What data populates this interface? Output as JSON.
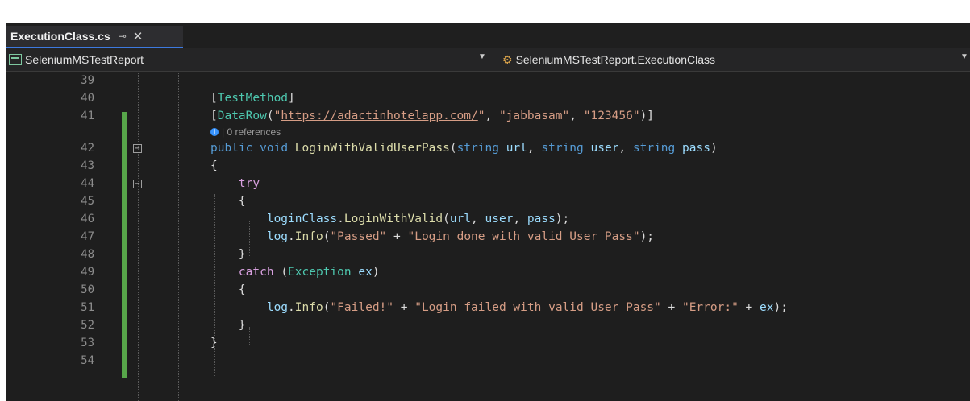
{
  "tab": {
    "title": "ExecutionClass.cs",
    "pin_icon": "pin-icon",
    "close_icon": "close-icon"
  },
  "navbar": {
    "project": "SeleniumMSTestReport",
    "class_path": "SeleniumMSTestReport.ExecutionClass"
  },
  "codelens": "| 0 references",
  "lines": {
    "l39": "39",
    "l40": "40",
    "l41": "41",
    "l42": "42",
    "l43": "43",
    "l44": "44",
    "l45": "45",
    "l46": "46",
    "l47": "47",
    "l48": "48",
    "l49": "49",
    "l50": "50",
    "l51": "51",
    "l52": "52",
    "l53": "53",
    "l54": "54"
  },
  "code": {
    "l40_attr": "TestMethod",
    "l41_attr": "DataRow",
    "l41_url": "https://adactinhotelapp.com/",
    "l41_user": "\"jabbasam\"",
    "l41_pass": "\"123456\"",
    "l42_kw1": "public",
    "l42_kw2": "void",
    "l42_method": "LoginWithValidUserPass",
    "l42_kw3": "string",
    "l42_p1": "url",
    "l42_kw4": "string",
    "l42_p2": "user",
    "l42_kw5": "string",
    "l42_p3": "pass",
    "l44_kw": "try",
    "l46_obj": "loginClass",
    "l46_method": "LoginWithValid",
    "l46_p1": "url",
    "l46_p2": "user",
    "l46_p3": "pass",
    "l47_obj": "log",
    "l47_method": "Info",
    "l47_s1": "\"Passed\"",
    "l47_s2": "\"Login done with valid User Pass\"",
    "l49_kw": "catch",
    "l49_type": "Exception",
    "l49_var": "ex",
    "l51_obj": "log",
    "l51_method": "Info",
    "l51_s1": "\"Failed!\"",
    "l51_s2": "\"Login failed with valid User Pass\"",
    "l51_s3": "\"Error:\"",
    "l51_var": "ex"
  },
  "colors": {
    "keyword": "#569cd6",
    "string": "#d69d85",
    "type": "#4ec9b0",
    "method": "#dcdcaa",
    "param": "#9cdcfe",
    "change_bar": "#57a64a",
    "tab_accent": "#3d7ae0"
  }
}
